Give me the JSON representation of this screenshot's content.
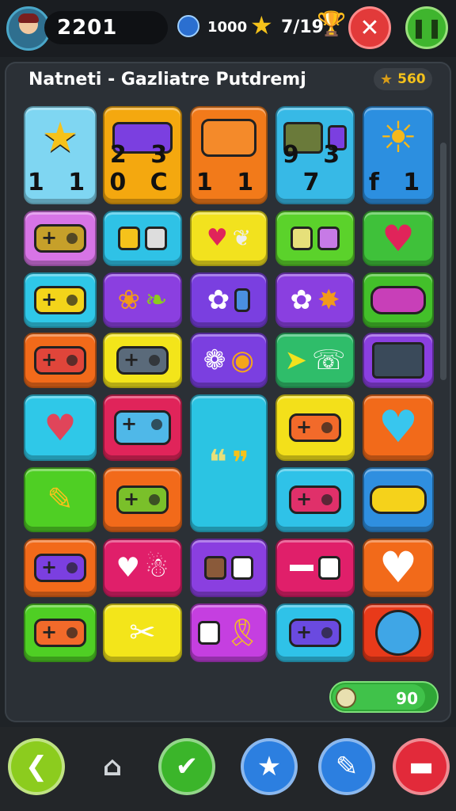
{
  "header": {
    "score": "2201",
    "coins": "1000",
    "stars": "7/19",
    "close_icon": "close-icon",
    "pause_icon": "pause-icon"
  },
  "board": {
    "title": "Natneti - Gazliatre Putdremj",
    "level": "560",
    "tiles": [
      {
        "color": "#7fd6f2",
        "icon": "star",
        "label": "1 1"
      },
      {
        "color": "#f4a80f",
        "icon": "purple-cart",
        "label": "2 3 0 C"
      },
      {
        "color": "#f27a1a",
        "icon": "radio",
        "label": "1 1"
      },
      {
        "color": "#37b9e6",
        "icon": "robot",
        "label": "9 3 7"
      },
      {
        "color": "#2c8fe0",
        "icon": "sun",
        "label": "f 1"
      },
      {
        "color": "#d774e6",
        "icon": "gamepad"
      },
      {
        "color": "#2fc2e6",
        "icon": "phone"
      },
      {
        "color": "#f2e21e",
        "icon": "heart-pair"
      },
      {
        "color": "#5bd22b",
        "icon": "frames"
      },
      {
        "color": "#3fc13a",
        "icon": "speech-heart"
      },
      {
        "color": "#2fc8e8",
        "icon": "bus"
      },
      {
        "color": "#8b3fe0",
        "icon": "leaf"
      },
      {
        "color": "#7a3fe0",
        "icon": "gear"
      },
      {
        "color": "#8a3fe0",
        "icon": "flower"
      },
      {
        "color": "#43c02a",
        "icon": "car"
      },
      {
        "color": "#f26a1a",
        "icon": "gamepad-red"
      },
      {
        "color": "#f3e51a",
        "icon": "console"
      },
      {
        "color": "#7b3fe0",
        "icon": "donut"
      },
      {
        "color": "#2fbd6a",
        "icon": "chat"
      },
      {
        "color": "#8a3fe0",
        "icon": "tv"
      },
      {
        "color": "#2fc8e8",
        "icon": "bag"
      },
      {
        "color": "#e0245a",
        "icon": "controller"
      },
      {
        "color": "#2bc4e3",
        "icon": "speech-bubbles"
      },
      {
        "color": "#f3e01a",
        "icon": "handheld"
      },
      {
        "color": "#f26a1a",
        "icon": "blue-heart"
      },
      {
        "color": "#4fcf24",
        "icon": "pencil"
      },
      {
        "color": "#f26a1a",
        "icon": "gamepad-green"
      },
      {
        "color": "#2fc2e8",
        "icon": "console-pink"
      },
      {
        "color": "#2f8fe0",
        "icon": "yellow-car"
      },
      {
        "color": "#f26a1a",
        "icon": "switch"
      },
      {
        "color": "#e01f6a",
        "icon": "fruit"
      },
      {
        "color": "#8a3fe0",
        "icon": "dice"
      },
      {
        "color": "#e01f6a",
        "icon": "domino"
      },
      {
        "color": "#f26a1a",
        "icon": "white-heart"
      },
      {
        "color": "#4fcf24",
        "icon": "radio-orange"
      },
      {
        "color": "#f3e51a",
        "icon": "scissors"
      },
      {
        "color": "#c53fe0",
        "icon": "ribbon"
      },
      {
        "color": "#2fc2e8",
        "icon": "console-purple"
      },
      {
        "color": "#e83a1a",
        "icon": "face-ball"
      }
    ]
  },
  "progress": {
    "value": "90",
    "fraction": 0.9
  },
  "bottom_nav": [
    {
      "icon": "back-icon",
      "color": "#8ccc1e"
    },
    {
      "icon": "home-icon",
      "color": "transparent"
    },
    {
      "icon": "check-icon",
      "color": "#3bb52a"
    },
    {
      "icon": "star-icon",
      "color": "#2c7fe0"
    },
    {
      "icon": "paint-icon",
      "color": "#2c7fe0"
    },
    {
      "icon": "dumbbell-icon",
      "color": "#e22a3a"
    }
  ]
}
